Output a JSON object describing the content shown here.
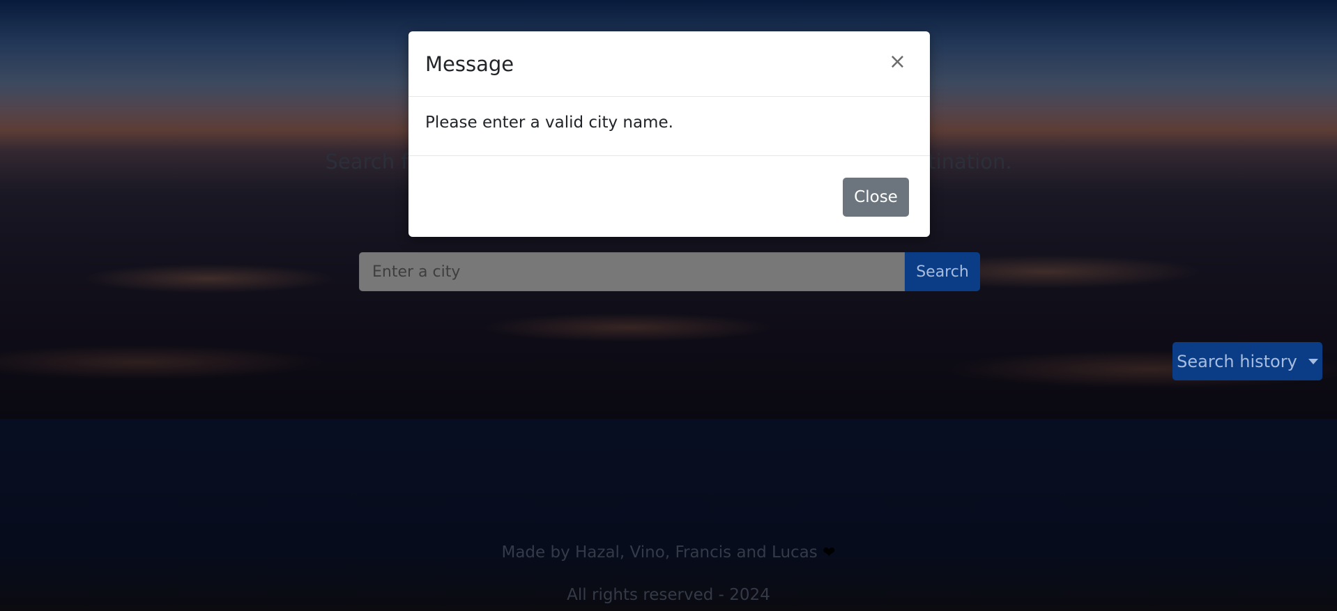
{
  "hero": {
    "tagline": "Search for a city to see the weather and plan your next destination."
  },
  "search": {
    "placeholder": "Enter a city",
    "button_label": "Search"
  },
  "history": {
    "button_label": "Search history"
  },
  "footer": {
    "made_by": "Made by Hazal, Vino, Francis and Lucas",
    "heart": "❤",
    "rights": "All rights reserved - 2024"
  },
  "modal": {
    "title": "Message",
    "close_x": "×",
    "body": "Please enter a valid city name.",
    "close_label": "Close"
  },
  "colors": {
    "primary": "#0d6efd",
    "secondary": "#6c757d"
  }
}
